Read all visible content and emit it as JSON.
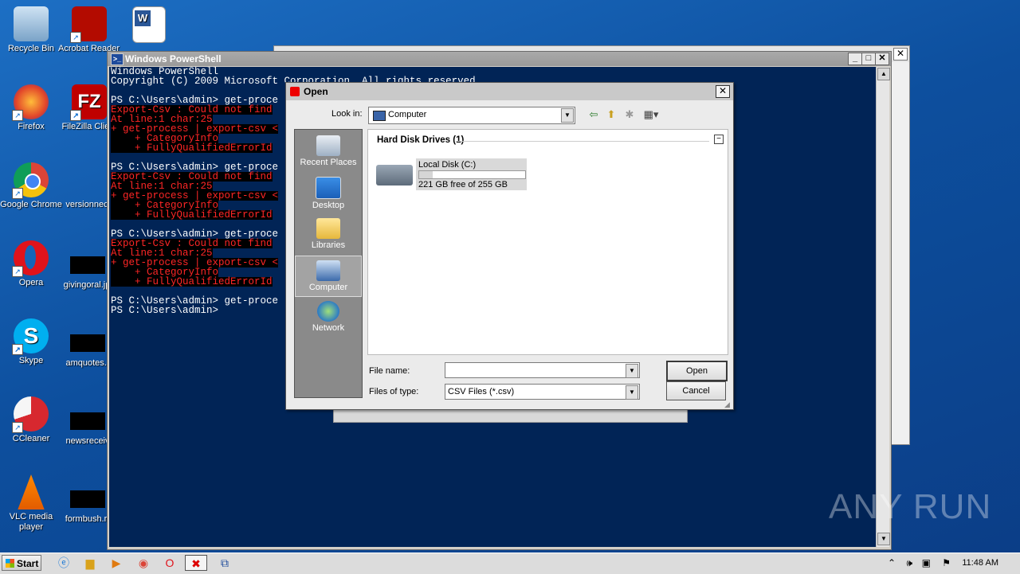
{
  "desktop": {
    "icons": [
      {
        "label": "Recycle Bin"
      },
      {
        "label": "Acrobat Reader DC"
      },
      {
        "label": "Firefox"
      },
      {
        "label": "FileZilla Client"
      },
      {
        "label": "Google Chrome"
      },
      {
        "label": "versionnec"
      },
      {
        "label": "Opera"
      },
      {
        "label": "givingoral.jp"
      },
      {
        "label": "Skype"
      },
      {
        "label": "amquotes.r"
      },
      {
        "label": "CCleaner"
      },
      {
        "label": "newsreceiv"
      },
      {
        "label": "VLC media player"
      },
      {
        "label": "formbush.r"
      }
    ]
  },
  "powershell": {
    "title": "Windows PowerShell",
    "lines": [
      {
        "t": "Windows PowerShell"
      },
      {
        "t": "Copyright (C) 2009 Microsoft Corporation. All rights reserved."
      },
      {
        "t": ""
      },
      {
        "t": "PS C:\\Users\\admin> get-proce"
      },
      {
        "t": "Export-Csv : Could not find",
        "err": true
      },
      {
        "t": "At line:1 char:25",
        "err": true
      },
      {
        "t": "+ get-process | export-csv <",
        "err": true
      },
      {
        "t": "    + CategoryInfo",
        "err": true
      },
      {
        "t": "    + FullyQualifiedErrorId",
        "err": true
      },
      {
        "t": ""
      },
      {
        "t": "PS C:\\Users\\admin> get-proce"
      },
      {
        "t": "Export-Csv : Could not find",
        "err": true
      },
      {
        "t": "At line:1 char:25",
        "err": true
      },
      {
        "t": "+ get-process | export-csv <",
        "err": true
      },
      {
        "t": "    + CategoryInfo",
        "err": true
      },
      {
        "t": "    + FullyQualifiedErrorId",
        "err": true
      },
      {
        "t": ""
      },
      {
        "t": "PS C:\\Users\\admin> get-proce"
      },
      {
        "t": "Export-Csv : Could not find",
        "err": true
      },
      {
        "t": "At line:1 char:25",
        "err": true
      },
      {
        "t": "+ get-process | export-csv <",
        "err": true
      },
      {
        "t": "    + CategoryInfo",
        "err": true
      },
      {
        "t": "    + FullyQualifiedErrorId",
        "err": true
      },
      {
        "t": ""
      },
      {
        "t": "PS C:\\Users\\admin> get-proce"
      },
      {
        "t": "PS C:\\Users\\admin>"
      }
    ]
  },
  "dialog": {
    "title": "Open",
    "look_in_label": "Look in:",
    "look_in_value": "Computer",
    "places": [
      {
        "label": "Recent Places"
      },
      {
        "label": "Desktop"
      },
      {
        "label": "Libraries"
      },
      {
        "label": "Computer"
      },
      {
        "label": "Network"
      }
    ],
    "group_header": "Hard Disk Drives (1)",
    "drive": {
      "name": "Local Disk (C:)",
      "free_text": "221 GB free of 255 GB",
      "used_fraction": 0.13
    },
    "file_name_label": "File name:",
    "file_name_value": "",
    "file_type_label": "Files of type:",
    "file_type_value": "CSV Files (*.csv)",
    "open_button": "Open",
    "cancel_button": "Cancel"
  },
  "taskbar": {
    "start_label": "Start",
    "clock": "11:48 AM"
  },
  "watermark": "ANY RUN"
}
